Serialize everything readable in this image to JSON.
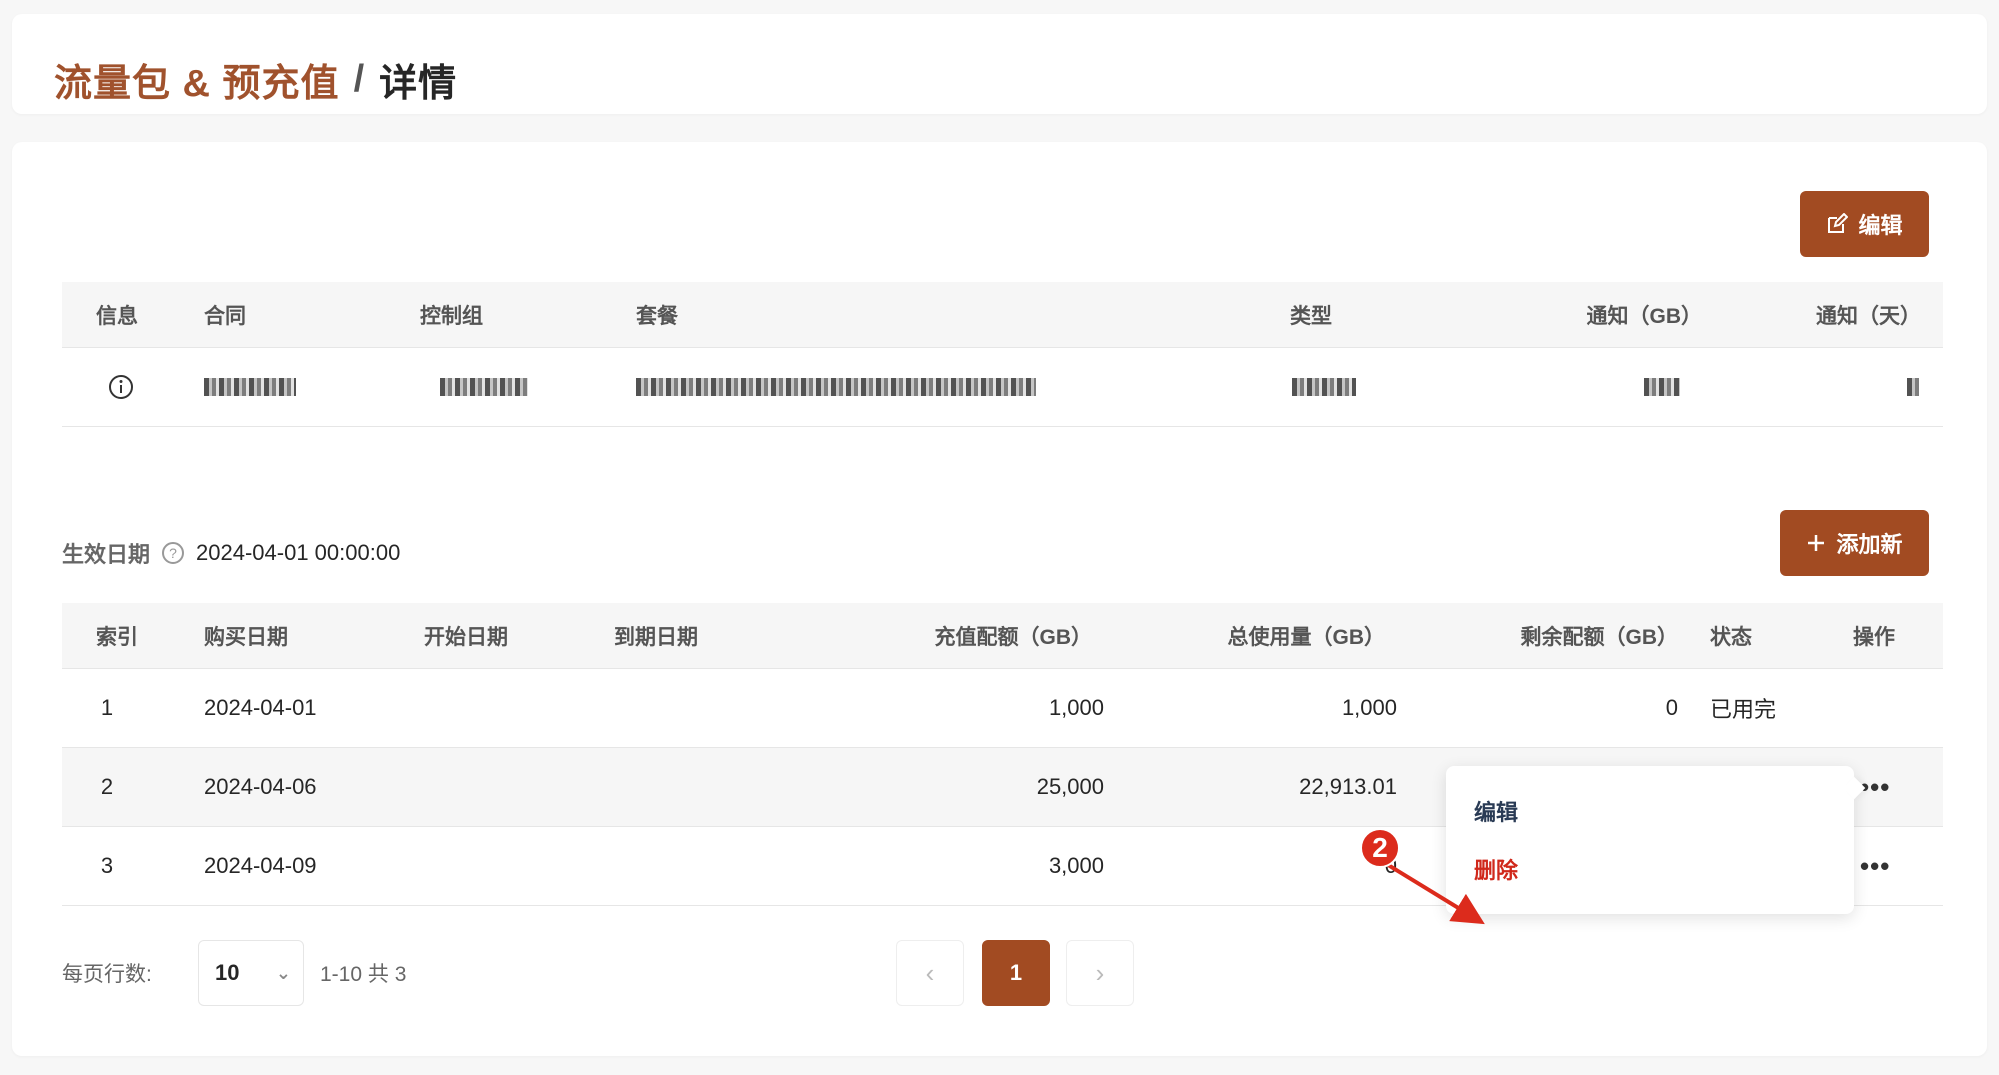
{
  "breadcrumb": {
    "parent": "流量包 & 预充值",
    "separator": "/",
    "current": "详情"
  },
  "actions": {
    "edit_label": "编辑",
    "add_label": "添加新"
  },
  "info_table": {
    "headers": [
      "信息",
      "合同",
      "控制组",
      "套餐",
      "类型",
      "通知（GB）",
      "通知（天）"
    ]
  },
  "effective": {
    "label": "生效日期",
    "value": "2024-04-01 00:00:00"
  },
  "list_table": {
    "headers": [
      "索引",
      "购买日期",
      "开始日期",
      "到期日期",
      "充值配额（GB）",
      "总使用量（GB）",
      "剩余配额（GB）",
      "状态",
      "操作"
    ],
    "rows": [
      {
        "index": "1",
        "purchase": "2024-04-01",
        "start": "",
        "end": "",
        "quota": "1,000",
        "used": "1,000",
        "remaining": "0",
        "status": "已用完"
      },
      {
        "index": "2",
        "purchase": "2024-04-06",
        "start": "",
        "end": "",
        "quota": "25,000",
        "used": "22,913.01",
        "remaining": "",
        "status": ""
      },
      {
        "index": "3",
        "purchase": "2024-04-09",
        "start": "",
        "end": "",
        "quota": "3,000",
        "used": "0",
        "remaining": "",
        "status": ""
      }
    ]
  },
  "menu": {
    "edit": "编辑",
    "delete": "删除"
  },
  "callout": {
    "number": "2"
  },
  "pagination": {
    "rows_label": "每页行数:",
    "page_size": "10",
    "range": "1-10 共 3",
    "current_page": "1"
  },
  "colors": {
    "brand": "#a24b22",
    "danger": "#d0281b",
    "callout": "#dc2b1c"
  }
}
